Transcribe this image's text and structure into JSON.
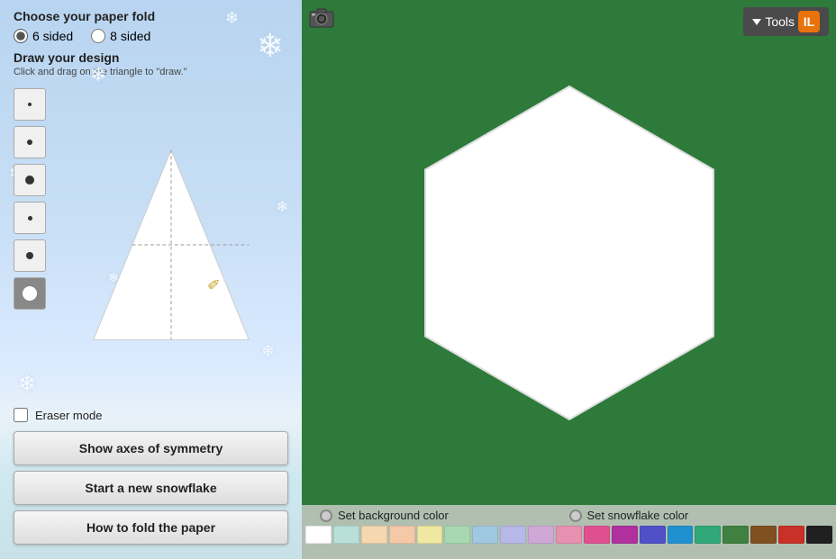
{
  "left_panel": {
    "fold_title": "Choose your paper fold",
    "option_6": "6 sided",
    "option_8": "8 sided",
    "draw_title": "Draw your design",
    "draw_subtitle": "Click and drag on the triangle to \"draw.\"",
    "eraser_label": "Eraser mode",
    "btn_axes": "Show axes of symmetry",
    "btn_new": "Start a new snowflake",
    "btn_how": "How to fold the paper"
  },
  "right_panel": {
    "tools_label": "Tools",
    "tools_icon_text": "IL",
    "bg_color_label": "Set background color",
    "snow_color_label": "Set snowflake color"
  },
  "brush_sizes": [
    {
      "size": 4,
      "id": "xs"
    },
    {
      "size": 6,
      "id": "sm"
    },
    {
      "size": 10,
      "id": "md"
    },
    {
      "size": 5,
      "id": "dot-sm"
    },
    {
      "size": 8,
      "id": "dot-md"
    },
    {
      "size": 16,
      "id": "lg",
      "active": true
    }
  ],
  "swatches": [
    "#ffffff",
    "#b8e0d8",
    "#f5d8b0",
    "#f5c8a8",
    "#f0e8a0",
    "#a8d8b0",
    "#a0c8e0",
    "#b8b8e8",
    "#d0a8d8",
    "#e890b0",
    "#e05090",
    "#b030a0",
    "#5050c8",
    "#2090d0",
    "#30a878",
    "#408040",
    "#805020",
    "#c83028",
    "#202020"
  ]
}
